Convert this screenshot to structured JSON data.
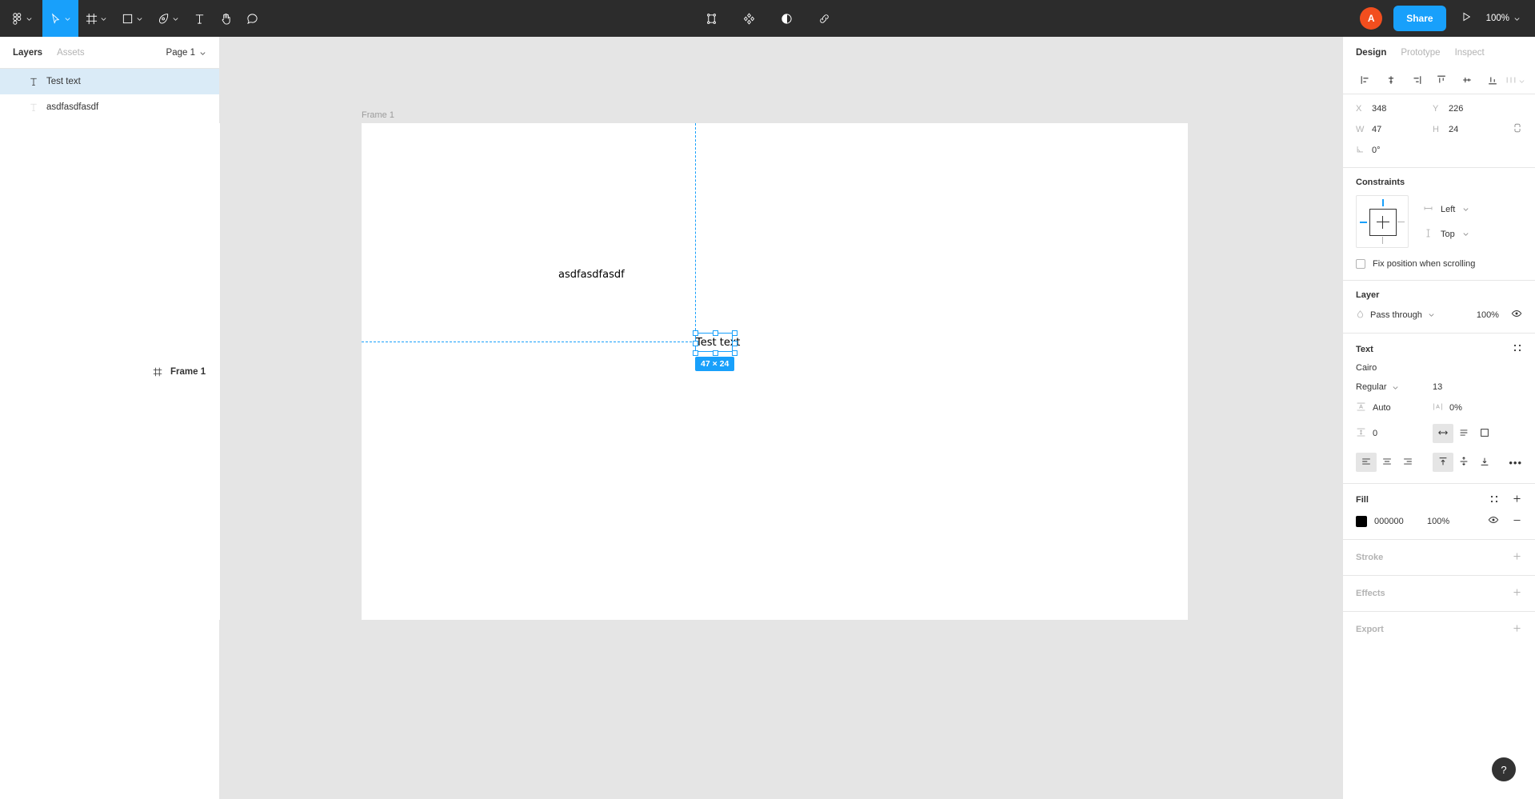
{
  "toolbar": {
    "menu_icon": "figma-logo-icon",
    "tools": [
      {
        "name": "move-tool",
        "icon": "cursor-icon",
        "active": true,
        "has_chevron": true
      },
      {
        "name": "frame-tool",
        "icon": "frame-icon",
        "active": false,
        "has_chevron": true
      },
      {
        "name": "shape-tool",
        "icon": "square-icon",
        "active": false,
        "has_chevron": true
      },
      {
        "name": "pen-tool",
        "icon": "pen-icon",
        "active": false,
        "has_chevron": true
      },
      {
        "name": "text-tool",
        "icon": "text-icon",
        "active": false,
        "has_chevron": false
      },
      {
        "name": "hand-tool",
        "icon": "hand-icon",
        "active": false,
        "has_chevron": false
      },
      {
        "name": "comment-tool",
        "icon": "comment-icon",
        "active": false,
        "has_chevron": false
      }
    ],
    "center_tools": [
      {
        "name": "create-component-button",
        "icon": "component-icon"
      },
      {
        "name": "plugins-button",
        "icon": "plugin-diamond-icon"
      },
      {
        "name": "mask-button",
        "icon": "mask-contrast-icon"
      },
      {
        "name": "link-button",
        "icon": "link-icon"
      }
    ],
    "avatar_initial": "A",
    "avatar_color": "#f24e1e",
    "share_label": "Share",
    "accent_color": "#18a0fb",
    "present_icon": "play-triangle-icon",
    "zoom_level": "100%"
  },
  "left_panel": {
    "tabs": [
      {
        "label": "Layers",
        "active": true
      },
      {
        "label": "Assets",
        "active": false
      }
    ],
    "page_name": "Page 1",
    "layers": [
      {
        "label": "Frame 1",
        "icon": "frame-icon",
        "type": "frame",
        "selected": false,
        "indent": 0
      },
      {
        "label": "Test text",
        "icon": "text-icon",
        "type": "text",
        "selected": true,
        "indent": 1
      },
      {
        "label": "asdfasdfasdf",
        "icon": "text-icon",
        "type": "text",
        "selected": false,
        "indent": 1,
        "dim": true
      }
    ]
  },
  "canvas": {
    "frame_label": "Frame 1",
    "texts": [
      {
        "name": "canvas-text-asdfasdfasdf",
        "content": "asdfasdfasdf"
      }
    ],
    "selection": {
      "content": "Test text",
      "size_badge": "47 × 24",
      "badge_color": "#18a0fb"
    }
  },
  "right_panel": {
    "tabs": [
      {
        "label": "Design",
        "active": true
      },
      {
        "label": "Prototype",
        "active": false
      },
      {
        "label": "Inspect",
        "active": false
      }
    ],
    "align_buttons": [
      {
        "name": "align-left-button",
        "icon": "align-left-icon"
      },
      {
        "name": "align-horizontal-center-button",
        "icon": "align-horizontal-center-icon"
      },
      {
        "name": "align-right-button",
        "icon": "align-right-icon"
      },
      {
        "name": "align-top-button",
        "icon": "align-top-icon"
      },
      {
        "name": "align-vertical-center-button",
        "icon": "align-vertical-center-icon"
      },
      {
        "name": "align-bottom-button",
        "icon": "align-bottom-icon"
      }
    ],
    "distribute_label": "distribute-icon",
    "position": {
      "x_label": "X",
      "x_value": "348",
      "y_label": "Y",
      "y_value": "226",
      "w_label": "W",
      "w_value": "47",
      "h_label": "H",
      "h_value": "24",
      "rotation_value": "0°",
      "constrain_proportions_icon": "link-broken-icon"
    },
    "constraints": {
      "title": "Constraints",
      "horizontal": "Left",
      "vertical": "Top",
      "fix_position_label": "Fix position when scrolling",
      "fix_position_checked": false,
      "marker_color": "#18a0fb"
    },
    "layer": {
      "title": "Layer",
      "blend_mode": "Pass through",
      "opacity": "100%",
      "visibility_icon": "eye-icon"
    },
    "text": {
      "title": "Text",
      "font_family": "Cairo",
      "font_weight": "Regular",
      "font_size": "13",
      "line_height": "Auto",
      "letter_spacing": "0%",
      "paragraph_spacing": "0",
      "resize_modes": [
        {
          "name": "auto-width-button",
          "icon": "auto-width-icon",
          "active": true
        },
        {
          "name": "auto-height-button",
          "icon": "auto-height-icon",
          "active": false
        },
        {
          "name": "fixed-size-button",
          "icon": "fixed-size-icon",
          "active": false
        }
      ],
      "horizontal_align": [
        {
          "name": "text-align-left-button",
          "icon": "text-align-left-icon",
          "active": true
        },
        {
          "name": "text-align-center-button",
          "icon": "text-align-center-icon",
          "active": false
        },
        {
          "name": "text-align-right-button",
          "icon": "text-align-right-icon",
          "active": false
        }
      ],
      "vertical_align": [
        {
          "name": "text-align-top-button",
          "icon": "text-align-top-icon",
          "active": true
        },
        {
          "name": "text-align-middle-button",
          "icon": "text-align-middle-icon",
          "active": false
        },
        {
          "name": "text-align-bottom-button",
          "icon": "text-align-bottom-icon",
          "active": false
        }
      ],
      "more_label": "•••"
    },
    "fill": {
      "title": "Fill",
      "hex": "000000",
      "color": "#000000",
      "opacity": "100%"
    },
    "stroke": {
      "title": "Stroke"
    },
    "effects": {
      "title": "Effects"
    },
    "export": {
      "title": "Export"
    }
  },
  "help": {
    "label": "?"
  }
}
